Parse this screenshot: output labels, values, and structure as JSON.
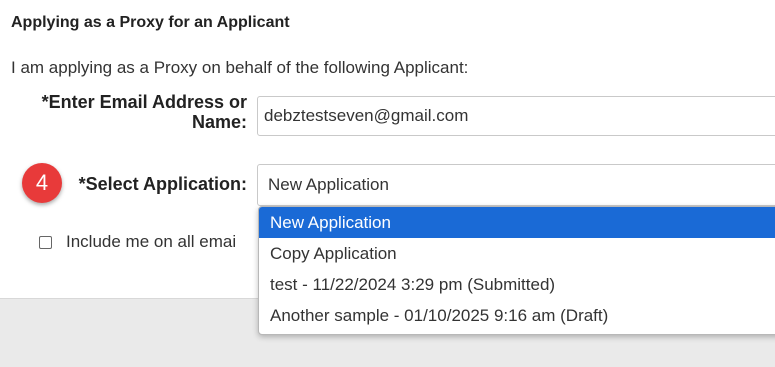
{
  "section": {
    "title": "Applying as a Proxy for an Applicant",
    "intro": "I am applying as a Proxy on behalf of the following Applicant:"
  },
  "email_field": {
    "label_line1": "*Enter Email Address or",
    "label_line2": "Name:",
    "value": "debztestseven@gmail.com"
  },
  "step_badge": "4",
  "application_field": {
    "label": "*Select Application:",
    "selected_value": "New Application",
    "options": [
      "New Application",
      "Copy Application",
      "test - 11/22/2024 3:29 pm (Submitted)",
      "Another sample - 01/10/2025 9:16 am (Draft)"
    ],
    "highlighted_index": 0
  },
  "email_checkbox": {
    "label": "Include me on all emai",
    "checked": false
  },
  "colors": {
    "badge": "#e83a3a",
    "option_highlight": "#1a6ad6"
  }
}
